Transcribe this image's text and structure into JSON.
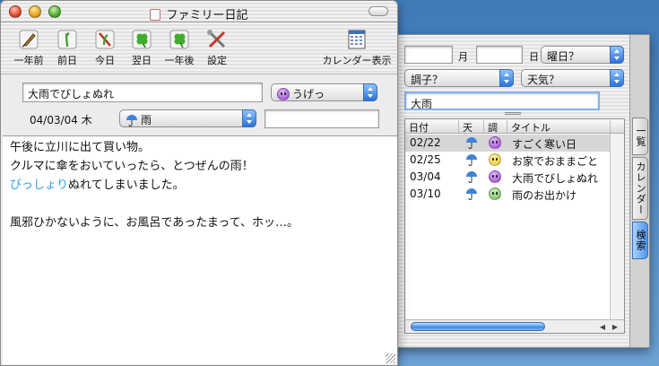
{
  "main": {
    "title": "ファミリー日記",
    "toolbar": [
      {
        "id": "prev-year",
        "label": "一年前",
        "icon": "quill-icon"
      },
      {
        "id": "prev-day",
        "label": "前日",
        "icon": "sprout-icon"
      },
      {
        "id": "today",
        "label": "今日",
        "icon": "today-icon"
      },
      {
        "id": "next-day",
        "label": "翌日",
        "icon": "clover-icon"
      },
      {
        "id": "next-year",
        "label": "一年後",
        "icon": "clover-icon"
      },
      {
        "id": "settings",
        "label": "設定",
        "icon": "tools-icon"
      }
    ],
    "calendar_label": "カレンダー表示",
    "entry_title": "大雨でびしょぬれ",
    "mood": "うげっ",
    "date": "04/03/04 木",
    "weather": "雨",
    "extra_field": "",
    "body_lines": [
      [
        {
          "text": "午後に立川に出て買い物。",
          "hl": false
        }
      ],
      [
        {
          "text": "クルマに傘をおいていったら、とつぜんの雨！",
          "hl": false
        }
      ],
      [
        {
          "text": "びっしょり",
          "hl": true
        },
        {
          "text": "ぬれてしまいました。",
          "hl": false
        }
      ],
      [
        {
          "text": "",
          "hl": false
        }
      ],
      [
        {
          "text": "風邪ひかないように、お風呂であったまって、ホッ…。",
          "hl": false
        }
      ]
    ],
    "highlight_color": "#2f9fe8"
  },
  "side": {
    "filter": {
      "year": "",
      "month_label": "月",
      "month": "",
      "day_label": "日",
      "weekday": "曜日？",
      "condition": "調子？",
      "weather": "天気？",
      "search": "大雨"
    },
    "columns": [
      "日付",
      "天",
      "調",
      "タイトル"
    ],
    "rows": [
      {
        "date": "02/22",
        "weather": "rain",
        "mood": "purple",
        "title": "すごく寒い日",
        "selected": true
      },
      {
        "date": "02/25",
        "weather": "rain",
        "mood": "yellow",
        "title": "お家でおままごと",
        "selected": false
      },
      {
        "date": "03/04",
        "weather": "rain",
        "mood": "purple",
        "title": "大雨でびしょぬれ",
        "selected": false
      },
      {
        "date": "03/10",
        "weather": "rain",
        "mood": "green",
        "title": "雨のお出かけ",
        "selected": false
      }
    ],
    "tabs": [
      "一覧",
      "カレンダー",
      "検索"
    ],
    "active_tab": "検索"
  }
}
